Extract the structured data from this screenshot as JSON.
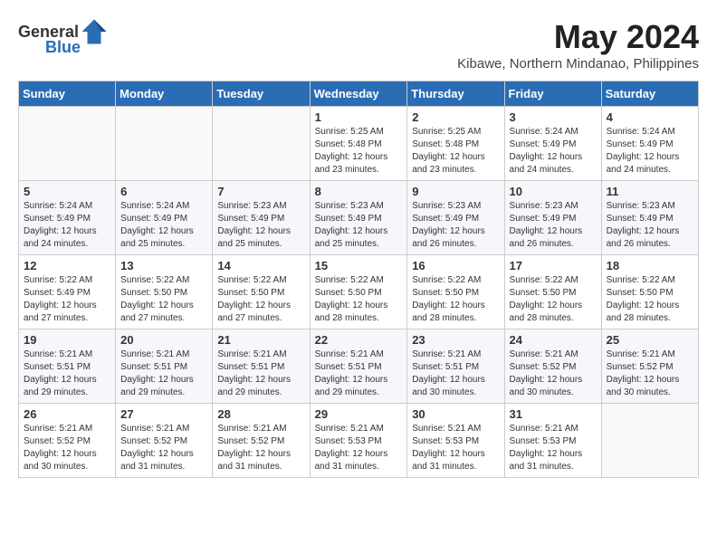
{
  "header": {
    "logo_general": "General",
    "logo_blue": "Blue",
    "month_year": "May 2024",
    "location": "Kibawe, Northern Mindanao, Philippines"
  },
  "weekdays": [
    "Sunday",
    "Monday",
    "Tuesday",
    "Wednesday",
    "Thursday",
    "Friday",
    "Saturday"
  ],
  "weeks": [
    [
      {
        "day": "",
        "sunrise": "",
        "sunset": "",
        "daylight": ""
      },
      {
        "day": "",
        "sunrise": "",
        "sunset": "",
        "daylight": ""
      },
      {
        "day": "",
        "sunrise": "",
        "sunset": "",
        "daylight": ""
      },
      {
        "day": "1",
        "sunrise": "Sunrise: 5:25 AM",
        "sunset": "Sunset: 5:48 PM",
        "daylight": "Daylight: 12 hours and 23 minutes."
      },
      {
        "day": "2",
        "sunrise": "Sunrise: 5:25 AM",
        "sunset": "Sunset: 5:48 PM",
        "daylight": "Daylight: 12 hours and 23 minutes."
      },
      {
        "day": "3",
        "sunrise": "Sunrise: 5:24 AM",
        "sunset": "Sunset: 5:49 PM",
        "daylight": "Daylight: 12 hours and 24 minutes."
      },
      {
        "day": "4",
        "sunrise": "Sunrise: 5:24 AM",
        "sunset": "Sunset: 5:49 PM",
        "daylight": "Daylight: 12 hours and 24 minutes."
      }
    ],
    [
      {
        "day": "5",
        "sunrise": "Sunrise: 5:24 AM",
        "sunset": "Sunset: 5:49 PM",
        "daylight": "Daylight: 12 hours and 24 minutes."
      },
      {
        "day": "6",
        "sunrise": "Sunrise: 5:24 AM",
        "sunset": "Sunset: 5:49 PM",
        "daylight": "Daylight: 12 hours and 25 minutes."
      },
      {
        "day": "7",
        "sunrise": "Sunrise: 5:23 AM",
        "sunset": "Sunset: 5:49 PM",
        "daylight": "Daylight: 12 hours and 25 minutes."
      },
      {
        "day": "8",
        "sunrise": "Sunrise: 5:23 AM",
        "sunset": "Sunset: 5:49 PM",
        "daylight": "Daylight: 12 hours and 25 minutes."
      },
      {
        "day": "9",
        "sunrise": "Sunrise: 5:23 AM",
        "sunset": "Sunset: 5:49 PM",
        "daylight": "Daylight: 12 hours and 26 minutes."
      },
      {
        "day": "10",
        "sunrise": "Sunrise: 5:23 AM",
        "sunset": "Sunset: 5:49 PM",
        "daylight": "Daylight: 12 hours and 26 minutes."
      },
      {
        "day": "11",
        "sunrise": "Sunrise: 5:23 AM",
        "sunset": "Sunset: 5:49 PM",
        "daylight": "Daylight: 12 hours and 26 minutes."
      }
    ],
    [
      {
        "day": "12",
        "sunrise": "Sunrise: 5:22 AM",
        "sunset": "Sunset: 5:49 PM",
        "daylight": "Daylight: 12 hours and 27 minutes."
      },
      {
        "day": "13",
        "sunrise": "Sunrise: 5:22 AM",
        "sunset": "Sunset: 5:50 PM",
        "daylight": "Daylight: 12 hours and 27 minutes."
      },
      {
        "day": "14",
        "sunrise": "Sunrise: 5:22 AM",
        "sunset": "Sunset: 5:50 PM",
        "daylight": "Daylight: 12 hours and 27 minutes."
      },
      {
        "day": "15",
        "sunrise": "Sunrise: 5:22 AM",
        "sunset": "Sunset: 5:50 PM",
        "daylight": "Daylight: 12 hours and 28 minutes."
      },
      {
        "day": "16",
        "sunrise": "Sunrise: 5:22 AM",
        "sunset": "Sunset: 5:50 PM",
        "daylight": "Daylight: 12 hours and 28 minutes."
      },
      {
        "day": "17",
        "sunrise": "Sunrise: 5:22 AM",
        "sunset": "Sunset: 5:50 PM",
        "daylight": "Daylight: 12 hours and 28 minutes."
      },
      {
        "day": "18",
        "sunrise": "Sunrise: 5:22 AM",
        "sunset": "Sunset: 5:50 PM",
        "daylight": "Daylight: 12 hours and 28 minutes."
      }
    ],
    [
      {
        "day": "19",
        "sunrise": "Sunrise: 5:21 AM",
        "sunset": "Sunset: 5:51 PM",
        "daylight": "Daylight: 12 hours and 29 minutes."
      },
      {
        "day": "20",
        "sunrise": "Sunrise: 5:21 AM",
        "sunset": "Sunset: 5:51 PM",
        "daylight": "Daylight: 12 hours and 29 minutes."
      },
      {
        "day": "21",
        "sunrise": "Sunrise: 5:21 AM",
        "sunset": "Sunset: 5:51 PM",
        "daylight": "Daylight: 12 hours and 29 minutes."
      },
      {
        "day": "22",
        "sunrise": "Sunrise: 5:21 AM",
        "sunset": "Sunset: 5:51 PM",
        "daylight": "Daylight: 12 hours and 29 minutes."
      },
      {
        "day": "23",
        "sunrise": "Sunrise: 5:21 AM",
        "sunset": "Sunset: 5:51 PM",
        "daylight": "Daylight: 12 hours and 30 minutes."
      },
      {
        "day": "24",
        "sunrise": "Sunrise: 5:21 AM",
        "sunset": "Sunset: 5:52 PM",
        "daylight": "Daylight: 12 hours and 30 minutes."
      },
      {
        "day": "25",
        "sunrise": "Sunrise: 5:21 AM",
        "sunset": "Sunset: 5:52 PM",
        "daylight": "Daylight: 12 hours and 30 minutes."
      }
    ],
    [
      {
        "day": "26",
        "sunrise": "Sunrise: 5:21 AM",
        "sunset": "Sunset: 5:52 PM",
        "daylight": "Daylight: 12 hours and 30 minutes."
      },
      {
        "day": "27",
        "sunrise": "Sunrise: 5:21 AM",
        "sunset": "Sunset: 5:52 PM",
        "daylight": "Daylight: 12 hours and 31 minutes."
      },
      {
        "day": "28",
        "sunrise": "Sunrise: 5:21 AM",
        "sunset": "Sunset: 5:52 PM",
        "daylight": "Daylight: 12 hours and 31 minutes."
      },
      {
        "day": "29",
        "sunrise": "Sunrise: 5:21 AM",
        "sunset": "Sunset: 5:53 PM",
        "daylight": "Daylight: 12 hours and 31 minutes."
      },
      {
        "day": "30",
        "sunrise": "Sunrise: 5:21 AM",
        "sunset": "Sunset: 5:53 PM",
        "daylight": "Daylight: 12 hours and 31 minutes."
      },
      {
        "day": "31",
        "sunrise": "Sunrise: 5:21 AM",
        "sunset": "Sunset: 5:53 PM",
        "daylight": "Daylight: 12 hours and 31 minutes."
      },
      {
        "day": "",
        "sunrise": "",
        "sunset": "",
        "daylight": ""
      }
    ]
  ]
}
